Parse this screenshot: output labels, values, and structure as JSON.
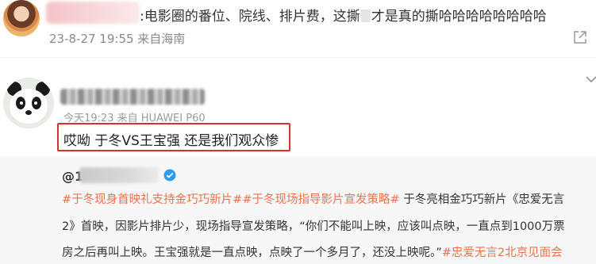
{
  "colors": {
    "topic": "#eb7350",
    "highlight_border": "#d9312d",
    "verified": "#2d9bf0",
    "meta_text": "#8a8a8a",
    "quote_background": "#f7f7f7"
  },
  "post": {
    "text_prefix": ":电影圈的番位、院线、排片费，这撕",
    "text_suffix": "才是真的撕哈哈哈哈哈哈哈哈",
    "meta": "23-8-27 19:55 来自海南",
    "share_icon": "share-icon"
  },
  "comment": {
    "meta": "今天19:23 来自 HUAWEI P60",
    "text": "哎呦 于冬VS王宝强 还是我们观众惨",
    "menu_icon": "chevron-down-icon"
  },
  "quoted": {
    "at": "@1",
    "verified_icon": "verified-icon",
    "line1_topic1": "#于冬现身首映礼支持金巧巧新片#",
    "line1_topic2": "#于冬现场指导影片宣发策略#",
    "line1_text": " 于冬亮相金巧巧新片《忠爱无言",
    "line2_text": "2》首映，因影片排片少，现场指导宣发策略，“你们不能叫上映，应该叫点映，一直点到1000万票",
    "line3_text": "房之后再叫上映。王宝强就是一直点映，点映了一个多月了，还没上映呢。”",
    "line3_topic": "#忠爱无言2北京见面会"
  }
}
